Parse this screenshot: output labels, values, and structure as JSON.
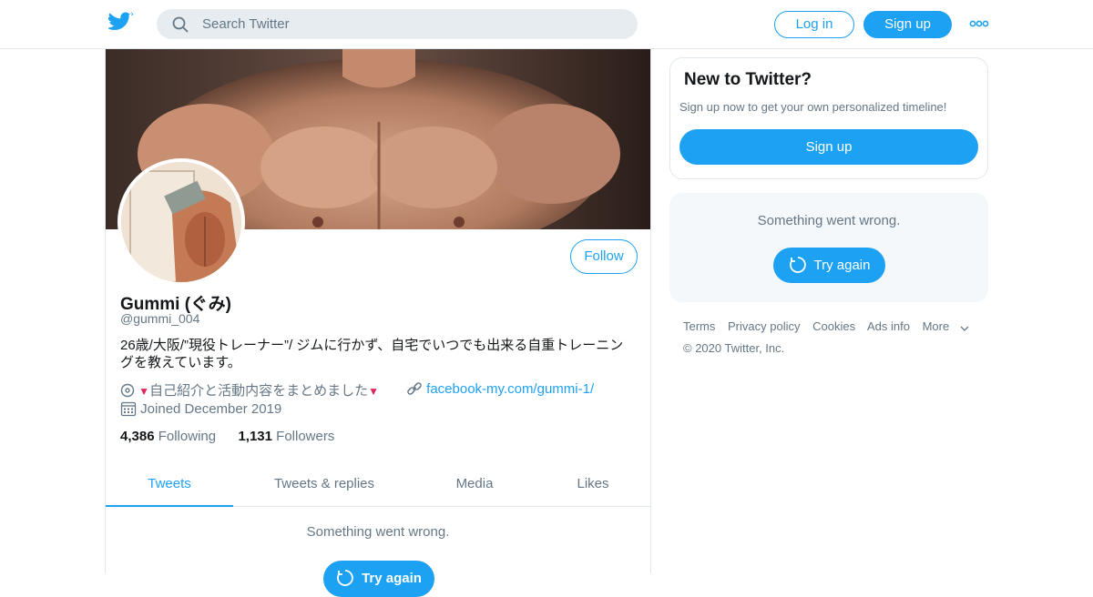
{
  "header": {
    "search_placeholder": "Search Twitter",
    "login_label": "Log in",
    "signup_label": "Sign up"
  },
  "profile": {
    "name": "Gummi (ぐみ)",
    "handle": "@gummi_004",
    "bio_line1": "26歳/大阪/”現役トレーナー”/ ジムに行かず、自宅でいつでも出来る自重トレーニン",
    "bio_line2": "グを教えています。",
    "location": "自己紹介と活動内容をまとめました",
    "website": "facebook-my.com/gummi-1/",
    "joined": "Joined December 2019",
    "following_count": "4,386",
    "following_label": "Following",
    "followers_count": "1,131",
    "followers_label": "Followers",
    "follow_label": "Follow"
  },
  "tabs": [
    {
      "label": "Tweets",
      "active": true
    },
    {
      "label": "Tweets & replies",
      "active": false
    },
    {
      "label": "Media",
      "active": false
    },
    {
      "label": "Likes",
      "active": false
    }
  ],
  "timeline": {
    "error_text": "Something went wrong.",
    "retry_label": "Try again"
  },
  "sidebar": {
    "new_title": "New to Twitter?",
    "new_subtitle": "Sign up now to get your own personalized timeline!",
    "signup_label": "Sign up",
    "error_text": "Something went wrong.",
    "retry_label": "Try again"
  },
  "footer": {
    "links": [
      "Terms",
      "Privacy policy",
      "Cookies",
      "Ads info",
      "More"
    ],
    "copyright": "© 2020 Twitter, Inc."
  },
  "colors": {
    "accent": "#1da1f2",
    "muted_text": "#657786",
    "heart": "#e0245e"
  }
}
